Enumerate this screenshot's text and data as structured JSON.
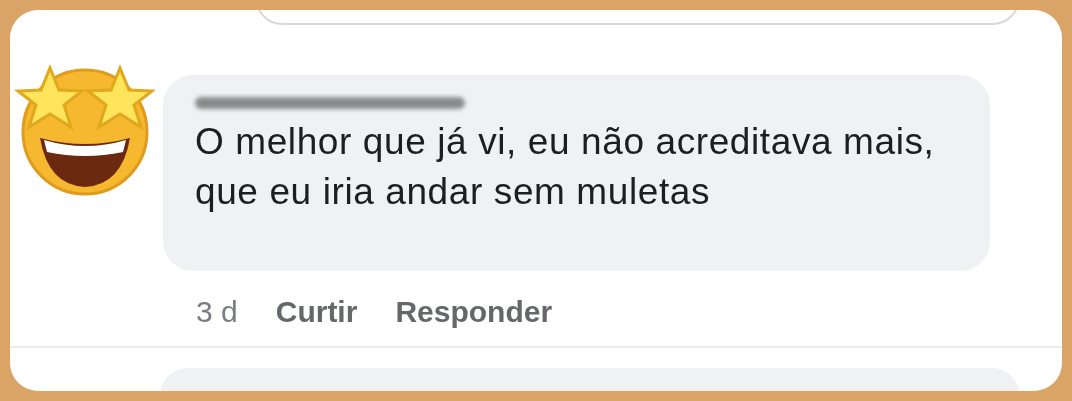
{
  "comment": {
    "text": "O melhor que já vi, eu não acreditava mais, que eu iria andar sem muletas",
    "name_redacted": true
  },
  "actions": [
    {
      "kind": "time",
      "label": "3 d"
    },
    {
      "kind": "link",
      "label": "Curtir"
    },
    {
      "kind": "link",
      "label": "Responder"
    }
  ]
}
